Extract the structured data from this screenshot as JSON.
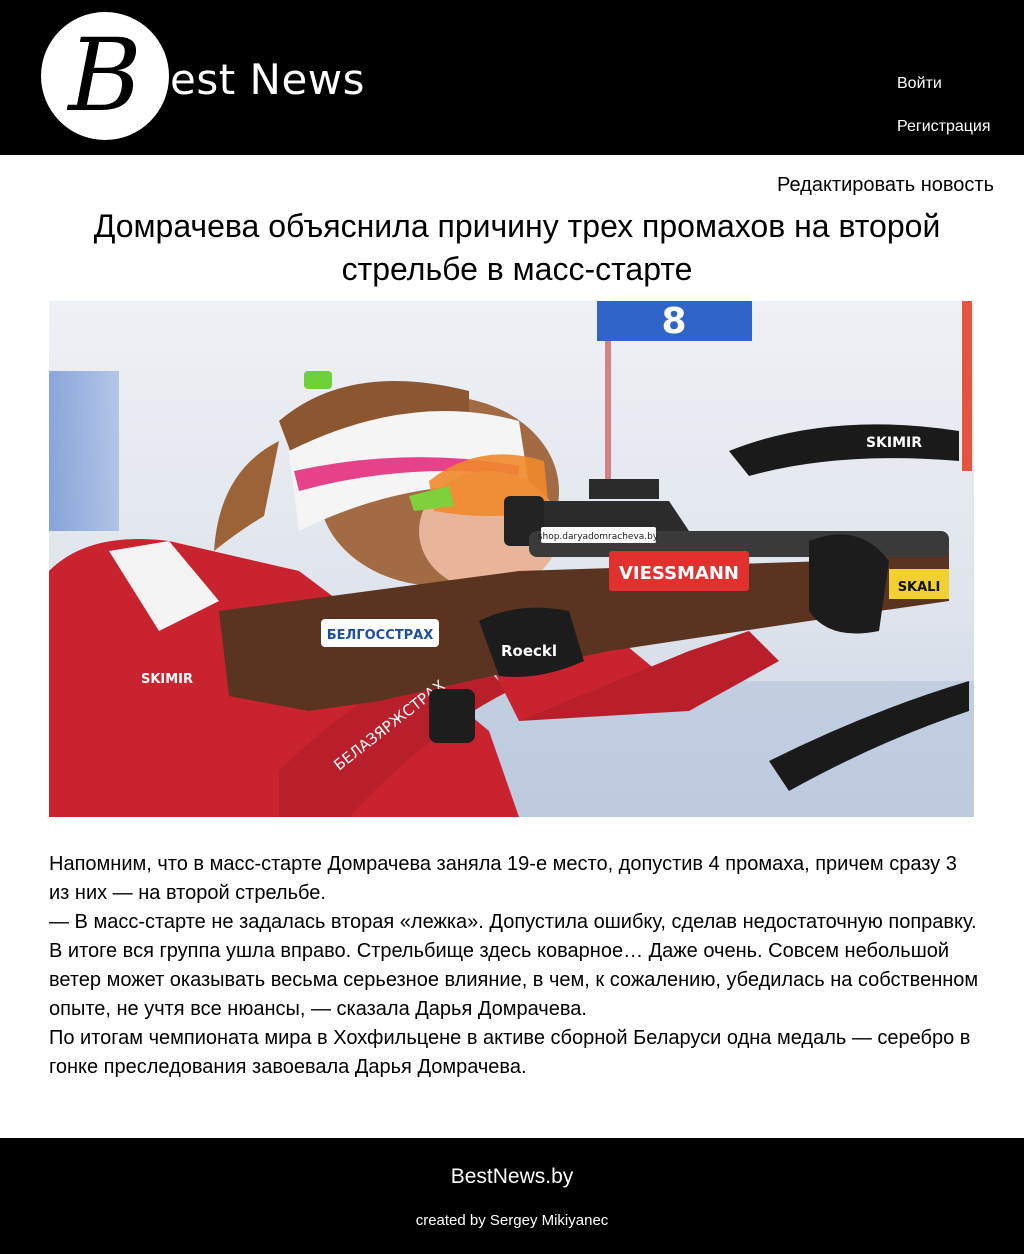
{
  "header": {
    "logo_letter": "B",
    "logo_rest": "est News",
    "nav": {
      "login": "Войти",
      "register": "Регистрация"
    }
  },
  "article": {
    "edit_link": "Редактировать новость",
    "title": "Домрачева объяснила причину трех промахов на второй стрельбе в масс-старте",
    "image": {
      "subject": "biathlete aiming rifle in prone position",
      "texts": [
        "VIESSMANN",
        "БЕЛГОССТРАХ",
        "SKIMIR",
        "Roeckl",
        "SKALI",
        "shop.daryadomracheva.by",
        "БЕЛАЗЯРЖСТРАХ",
        "8"
      ]
    },
    "paragraphs": [
      "Напомним, что в масс-старте Домрачева заняла 19-е место, допустив 4 промаха, причем сразу 3 из них — на второй стрельбе.",
      "— В масс-старте не задалась вторая «лежка». Допустила ошибку, сделав недостаточную поправку. В итоге вся группа ушла вправо. Стрельбище здесь коварное… Даже очень. Совсем небольшой ветер может оказывать весьма серьезное влияние, в чем, к сожалению, убедилась на собственном опыте, не учтя все нюансы, — сказала Дарья Домрачева.",
      "По итогам чемпионата мира в Хохфильцене в активе сборной Беларуси одна медаль — серебро в гонке преследования завоевала Дарья Домрачева."
    ]
  },
  "footer": {
    "site": "BestNews.by",
    "credit": "created by Sergey Mikiyanec"
  },
  "colors": {
    "header_bg": "#000000",
    "footer_bg": "#000000",
    "page_bg": "#ffffff",
    "jersey_red": "#c8232f",
    "banner_blue": "#2f64c9"
  }
}
